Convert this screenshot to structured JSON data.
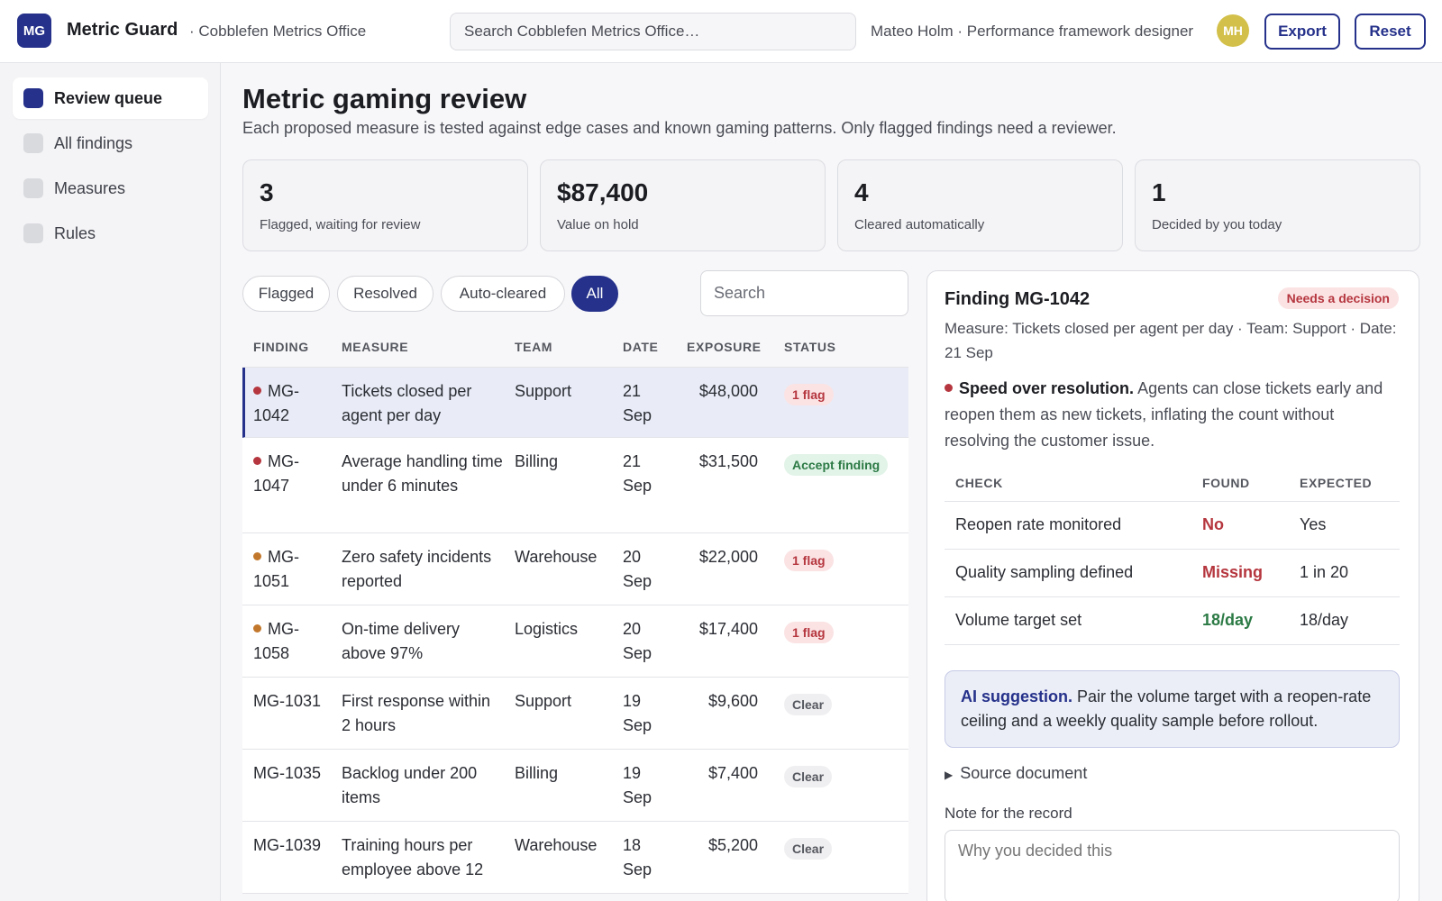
{
  "app": {
    "logo_text": "MG",
    "name": "Metric Guard",
    "org": "· Cobblefen Metrics Office"
  },
  "topbar": {
    "search_placeholder": "Search Cobblefen Metrics Office…",
    "user": "Mateo Holm · Performance framework designer",
    "avatar_initials": "MH",
    "export_label": "Export",
    "reset_label": "Reset"
  },
  "sidebar": {
    "items": [
      {
        "label": "Review queue",
        "active": true
      },
      {
        "label": "All findings",
        "active": false
      },
      {
        "label": "Measures",
        "active": false
      },
      {
        "label": "Rules",
        "active": false
      }
    ]
  },
  "main": {
    "title": "Metric gaming review",
    "subtitle": "Each proposed measure is tested against edge cases and known gaming patterns. Only flagged findings need a reviewer."
  },
  "stats": [
    {
      "value": "3",
      "label": "Flagged, waiting for review"
    },
    {
      "value": "$87,400",
      "label": "Value on hold"
    },
    {
      "value": "4",
      "label": "Cleared automatically"
    },
    {
      "value": "1",
      "label": "Decided by you today"
    }
  ],
  "filters": [
    {
      "label": "Flagged",
      "active": false
    },
    {
      "label": "Resolved",
      "active": false
    },
    {
      "label": "Auto-cleared",
      "active": false
    },
    {
      "label": "All",
      "active": true
    }
  ],
  "list_search_placeholder": "Search",
  "table": {
    "headers": {
      "finding": "FINDING",
      "measure": "MEASURE",
      "team": "TEAM",
      "date": "DATE",
      "exposure": "EXPOSURE",
      "status": "STATUS"
    },
    "rows": [
      {
        "finding": "MG-1042",
        "measure": "Tickets closed per agent per day",
        "team": "Support",
        "date": "21 Sep",
        "exposure": "$48,000",
        "status": "1 flag",
        "status_kind": "flag",
        "dot": "#b5363e",
        "selected": true
      },
      {
        "finding": "MG-1047",
        "measure": "Average handling time under 6 minutes",
        "team": "Billing",
        "date": "21 Sep",
        "exposure": "$31,500",
        "status": "Accept finding",
        "status_kind": "accept",
        "dot": "#b5363e",
        "selected": false
      },
      {
        "finding": "MG-1051",
        "measure": "Zero safety incidents reported",
        "team": "Warehouse",
        "date": "20 Sep",
        "exposure": "$22,000",
        "status": "1 flag",
        "status_kind": "flag",
        "dot": "#c2782c",
        "selected": false
      },
      {
        "finding": "MG-1058",
        "measure": "On-time delivery above 97%",
        "team": "Logistics",
        "date": "20 Sep",
        "exposure": "$17,400",
        "status": "1 flag",
        "status_kind": "flag",
        "dot": "#c2782c",
        "selected": false
      },
      {
        "finding": "MG-1031",
        "measure": "First response within 2 hours",
        "team": "Support",
        "date": "19 Sep",
        "exposure": "$9,600",
        "status": "Clear",
        "status_kind": "clear",
        "dot": "",
        "selected": false
      },
      {
        "finding": "MG-1035",
        "measure": "Backlog under 200 items",
        "team": "Billing",
        "date": "19 Sep",
        "exposure": "$7,400",
        "status": "Clear",
        "status_kind": "clear",
        "dot": "",
        "selected": false
      },
      {
        "finding": "MG-1039",
        "measure": "Training hours per employee above 12",
        "team": "Warehouse",
        "date": "18 Sep",
        "exposure": "$5,200",
        "status": "Clear",
        "status_kind": "clear",
        "dot": "",
        "selected": false
      }
    ]
  },
  "detail": {
    "title": "Finding MG-1042",
    "badge": "Needs a decision",
    "meta": "Measure: Tickets closed per agent per day · Team: Support · Date: 21 Sep",
    "pattern_title": "Speed over resolution.",
    "pattern_text": "Agents can close tickets early and reopen them as new tickets, inflating the count without resolving the customer issue.",
    "checks_headers": {
      "check": "CHECK",
      "found": "FOUND",
      "expected": "EXPECTED"
    },
    "checks": [
      {
        "check": "Reopen rate monitored",
        "found": "No",
        "expected": "Yes",
        "ok": false
      },
      {
        "check": "Quality sampling defined",
        "found": "Missing",
        "expected": "1 in 20",
        "ok": false
      },
      {
        "check": "Volume target set",
        "found": "18/day",
        "expected": "18/day",
        "ok": true
      }
    ],
    "ai_label": "AI suggestion.",
    "ai_text": "Pair the volume target with a reopen-rate ceiling and a weekly quality sample before rollout.",
    "source_label": "Source document",
    "note_label": "Note for the record",
    "note_placeholder": "Why you decided this"
  },
  "colors": {
    "accent": "#25318a",
    "flag_bg": "#fbe3e4",
    "flag_fg": "#b5363e",
    "accept_bg": "#e2f3e8",
    "accept_fg": "#2c7a45",
    "clear_bg": "#efeff1",
    "clear_fg": "#55575f",
    "bad": "#b5363e",
    "good": "#2c7a45"
  }
}
